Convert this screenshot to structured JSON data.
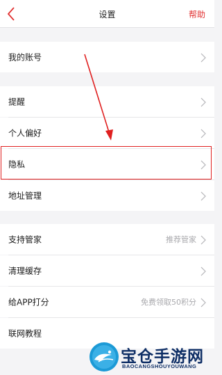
{
  "header": {
    "title": "设置",
    "help": "帮助"
  },
  "groups": [
    [
      {
        "label": "我的账号",
        "value": ""
      }
    ],
    [
      {
        "label": "提醒",
        "value": ""
      },
      {
        "label": "个人偏好",
        "value": ""
      },
      {
        "label": "隐私",
        "value": ""
      },
      {
        "label": "地址管理",
        "value": ""
      }
    ],
    [
      {
        "label": "支持管家",
        "value": "推荐管家"
      },
      {
        "label": "清理缓存",
        "value": ""
      },
      {
        "label": "给APP打分",
        "value": "免费领取50积分"
      },
      {
        "label": "联网教程",
        "value": ""
      }
    ]
  ],
  "watermark": {
    "main": "宝仓手游网",
    "sub": "BAOCANGSHOUYOUWANG"
  },
  "colors": {
    "accent": "#e13232",
    "highlight": "#e02020",
    "background": "#f4f4f6"
  }
}
